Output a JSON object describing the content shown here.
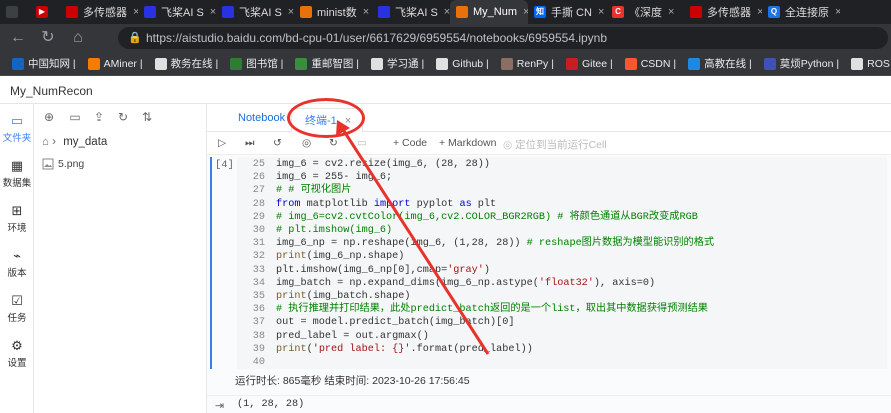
{
  "browser": {
    "tabs": [
      {
        "label": "",
        "color": "#3c4043",
        "glyph": ""
      },
      {
        "label": "",
        "color": "#cc0000",
        "glyph": "▶"
      },
      {
        "label": "多传感器",
        "color": "#c00",
        "glyph": ""
      },
      {
        "label": "飞桨AI S",
        "color": "#2932e1",
        "glyph": ""
      },
      {
        "label": "飞桨AI S",
        "color": "#2932e1",
        "glyph": ""
      },
      {
        "label": "minist数",
        "color": "#e8710a",
        "glyph": ""
      },
      {
        "label": "飞桨AI S",
        "color": "#2932e1",
        "glyph": ""
      },
      {
        "label": "My_Num",
        "color": "#e8710a",
        "glyph": "",
        "active": true
      },
      {
        "label": "手撕 CN",
        "color": "#0066ff",
        "glyph": "知"
      },
      {
        "label": "《深度",
        "color": "#e8322c",
        "glyph": "C"
      },
      {
        "label": "多传感器",
        "color": "#c00",
        "glyph": ""
      },
      {
        "label": "全连接原",
        "color": "#1a73e8",
        "glyph": "Q"
      }
    ],
    "url": "https://aistudio.baidu.com/bd-cpu-01/user/6617629/6959554/notebooks/6959554.ipynb",
    "bookmarks": [
      {
        "label": "中国知网 |",
        "color": "#1565c0"
      },
      {
        "label": "AMiner |",
        "color": "#f57c00"
      },
      {
        "label": "教务在线 |",
        "color": "#e0e0e0"
      },
      {
        "label": "图书馆 |",
        "color": "#2e7d32"
      },
      {
        "label": "重邮智图 |",
        "color": "#388e3c"
      },
      {
        "label": "学习通 |",
        "color": "#e0e0e0"
      },
      {
        "label": "Github |",
        "color": "#e0e0e0"
      },
      {
        "label": "RenPy |",
        "color": "#8d6e63"
      },
      {
        "label": "Gitee |",
        "color": "#c71d23"
      },
      {
        "label": "CSDN |",
        "color": "#fc5531"
      },
      {
        "label": "高教在线 |",
        "color": "#1e88e5"
      },
      {
        "label": "莫烦Python |",
        "color": "#3f51b5"
      },
      {
        "label": "ROS 赵虚左",
        "color": "#e0e0e0"
      }
    ]
  },
  "app": {
    "title": "My_NumRecon"
  },
  "leftnav": [
    {
      "label": "文件夹",
      "icon": "folder-icon",
      "active": true
    },
    {
      "label": "数据集",
      "icon": "dataset-icon"
    },
    {
      "label": "环境",
      "icon": "environment-icon"
    },
    {
      "label": "版本",
      "icon": "version-icon"
    },
    {
      "label": "任务",
      "icon": "task-icon"
    },
    {
      "label": "设置",
      "icon": "settings-icon"
    }
  ],
  "filepane": {
    "folder": "my_data",
    "file": "5.png"
  },
  "notebook": {
    "tabs": {
      "notebook": "Notebook",
      "terminal": "终端-1"
    },
    "toolbar": {
      "code": "+ Code",
      "markdown": "+ Markdown",
      "locate": "定位到当前运行Cell"
    },
    "prompt": "[4]",
    "lines": [
      {
        "n": "25",
        "t": "img_6 = cv2.resize(img_6, (28, 28))"
      },
      {
        "n": "26",
        "t": "img_6 = 255- img_6;"
      },
      {
        "n": "27",
        "t": "# # 可视化图片"
      },
      {
        "n": "28",
        "t": "from matplotlib import pyplot as plt"
      },
      {
        "n": "29",
        "t": "# img_6=cv2.cvtColor(img_6,cv2.COLOR_BGR2RGB) # 将颜色通道从BGR改变成RGB"
      },
      {
        "n": "30",
        "t": "# plt.imshow(img_6)"
      },
      {
        "n": "31",
        "t": "img_6_np = np.reshape(img_6, (1,28, 28)) # reshape图片数据为模型能识别的格式"
      },
      {
        "n": "32",
        "t": "print(img_6_np.shape)"
      },
      {
        "n": "33",
        "t": "plt.imshow(img_6_np[0],cmap='gray')"
      },
      {
        "n": "34",
        "t": "img_batch = np.expand_dims(img_6_np.astype('float32'), axis=0)"
      },
      {
        "n": "35",
        "t": "print(img_batch.shape)"
      },
      {
        "n": "36",
        "t": "# 执行推理并打印结果，此处predict_batch返回的是一个list，取出其中数据获得预测结果"
      },
      {
        "n": "37",
        "t": "out = model.predict_batch(img_batch)[0]"
      },
      {
        "n": "38",
        "t": "pred_label = out.argmax()"
      },
      {
        "n": "39",
        "t": "print('pred label: {}'.format(pred_label))"
      },
      {
        "n": "40",
        "t": ""
      }
    ],
    "runinfo": "运行时长: 865毫秒    结束时间: 2023-10-26 17:56:45",
    "output": "(1, 28, 28)"
  }
}
